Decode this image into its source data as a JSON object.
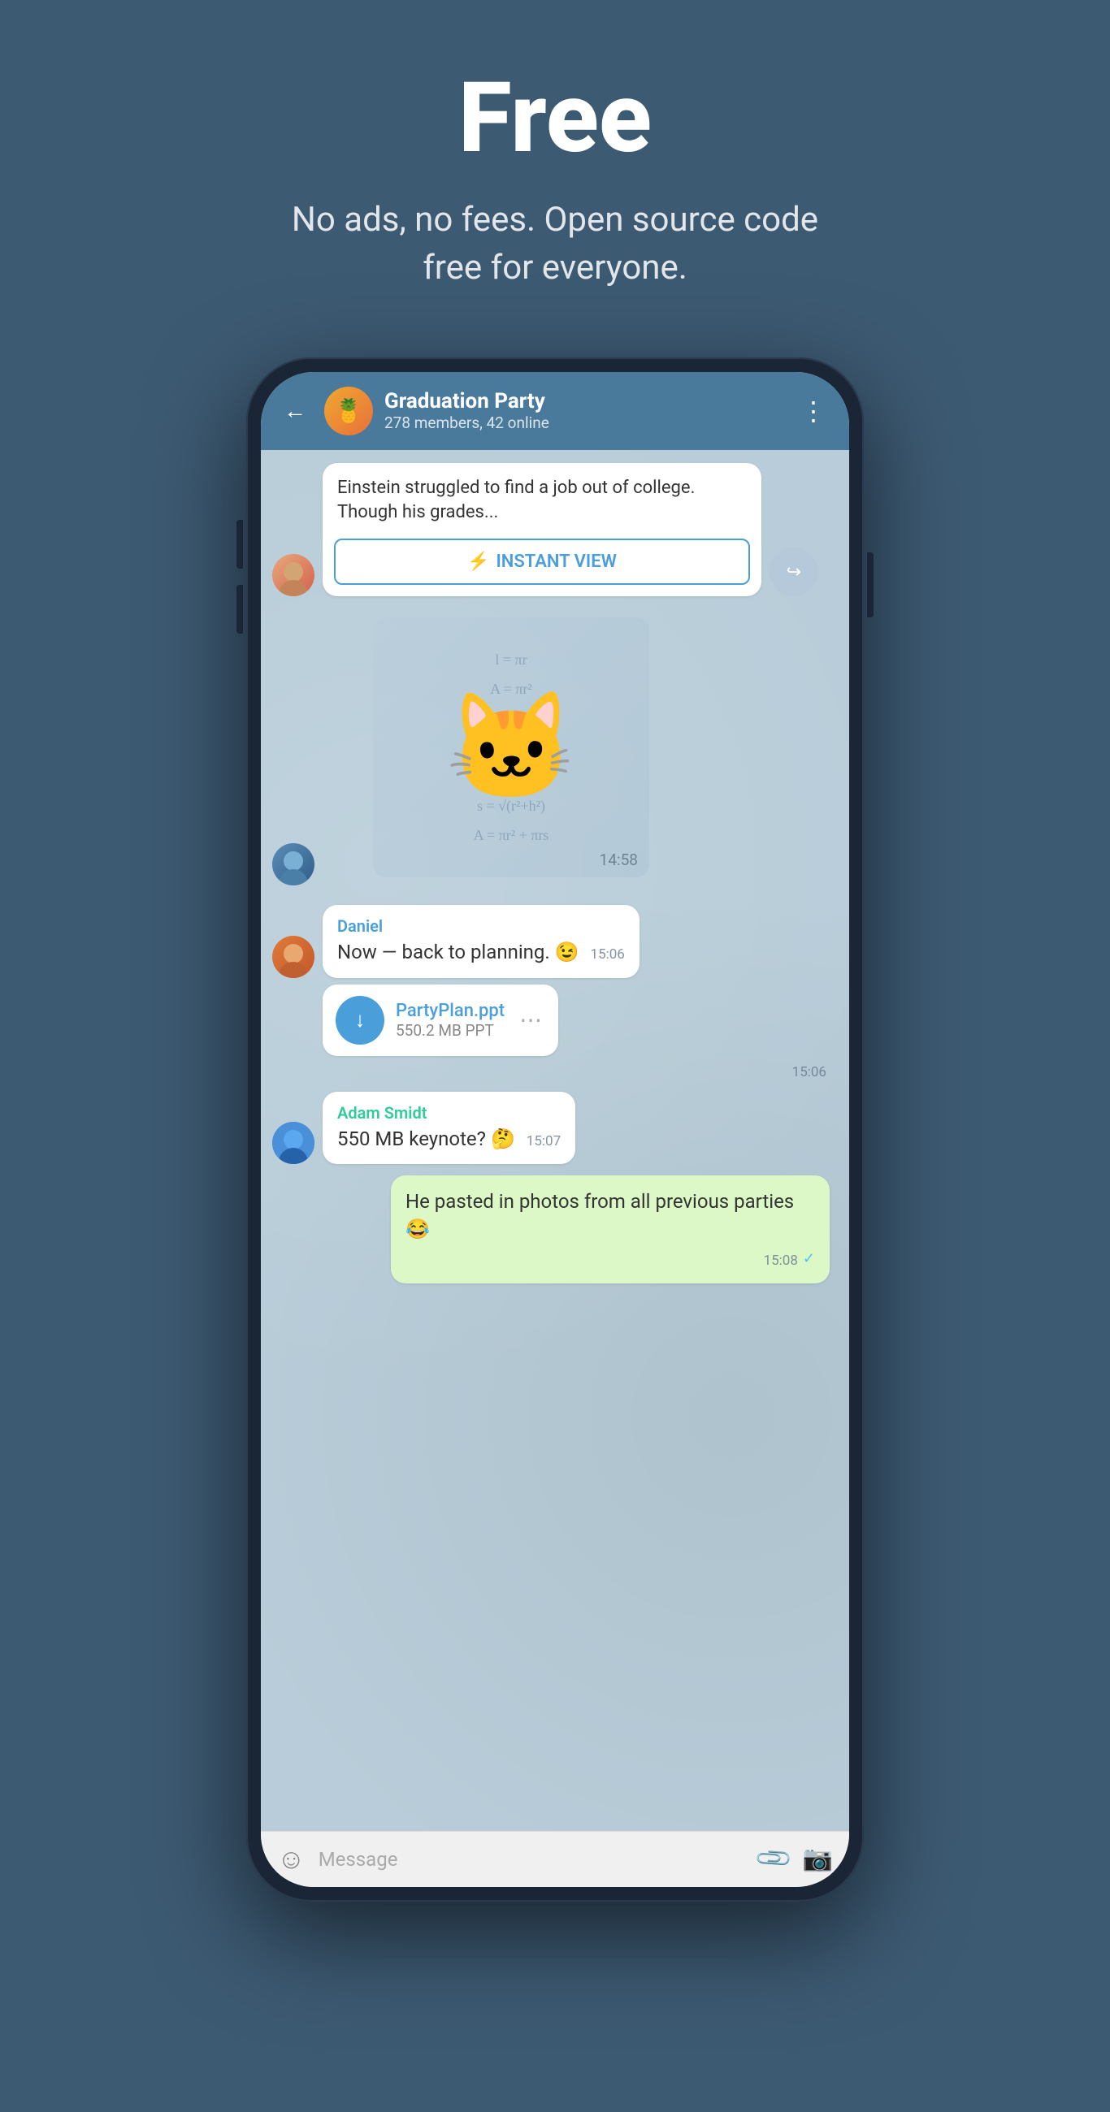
{
  "header": {
    "title": "Free",
    "subtitle": "No ads, no fees. Open source code free for everyone."
  },
  "chat": {
    "back_label": "←",
    "group_name": "Graduation Party",
    "group_status": "278 members, 42 online",
    "more_icon": "⋮",
    "avatar_emoji": "🍍"
  },
  "messages": [
    {
      "id": "article",
      "type": "article",
      "text": "Einstein struggled to find a job out of college. Though his grades...",
      "instant_view_label": "INSTANT VIEW",
      "share_icon": "↪"
    },
    {
      "id": "sticker",
      "type": "sticker",
      "time": "14:58",
      "sticker": "🐱"
    },
    {
      "id": "daniel-msg",
      "type": "received",
      "sender": "Daniel",
      "sender_color": "blue",
      "text": "Now — back to planning. 😉",
      "time": "15:06"
    },
    {
      "id": "file-msg",
      "type": "file",
      "file_name": "PartyPlan.ppt",
      "file_size": "550.2 MB PPT",
      "time": "15:06"
    },
    {
      "id": "adam-msg",
      "type": "received",
      "sender": "Adam Smidt",
      "sender_color": "teal",
      "text": "550 MB keynote? 🤔",
      "time": "15:07"
    },
    {
      "id": "my-msg",
      "type": "sent",
      "text": "He pasted in photos from all previous parties 😂",
      "time": "15:08"
    }
  ],
  "input_bar": {
    "placeholder": "Message",
    "emoji_icon": "☺",
    "attach_icon": "📎",
    "camera_icon": "📷"
  }
}
